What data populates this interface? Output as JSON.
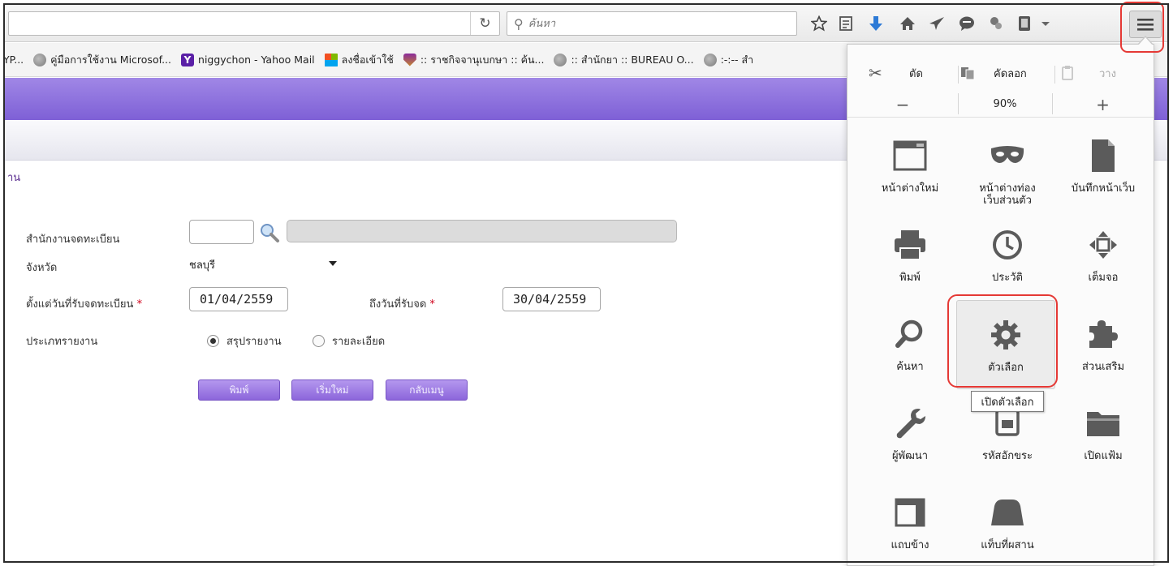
{
  "browser": {
    "search": {
      "placeholder": "ค้นหา"
    },
    "zoom_level": "90%",
    "bookmarks": [
      {
        "label": "YP...",
        "favicon_color": "#8a8a8a"
      },
      {
        "label": "คู่มือการใช้งาน Microsof...",
        "favicon_color": "#8a8a8a"
      },
      {
        "label": "niggychon - Yahoo Mail",
        "favicon_color": "#5a1fa6"
      },
      {
        "label": "ลงชื่อเข้าใช้",
        "favicon_color": "#f25022"
      },
      {
        "label": ":: ราชกิจจานุเบกษา :: ค้น...",
        "favicon_color": "#8b2a9c"
      },
      {
        "label": ":: สำนักยา :: BUREAU O...",
        "favicon_color": "#8a8a8a"
      },
      {
        "label": ":-:-- สำ",
        "favicon_color": "#8a8a8a"
      }
    ]
  },
  "menu": {
    "edit": {
      "cut": "ตัด",
      "copy": "คัดลอก",
      "paste": "วาง"
    },
    "zoom": {
      "minus": "−",
      "plus": "+"
    },
    "items": [
      {
        "label_line1": "หน้าต่างใหม่",
        "label_line2": ""
      },
      {
        "label_line1": "หน้าต่างท่อง",
        "label_line2": "เว็บส่วนตัว"
      },
      {
        "label_line1": "บันทึกหน้าเว็บ",
        "label_line2": ""
      },
      {
        "label_line1": "พิมพ์",
        "label_line2": ""
      },
      {
        "label_line1": "ประวัติ",
        "label_line2": ""
      },
      {
        "label_line1": "เต็มจอ",
        "label_line2": ""
      },
      {
        "label_line1": "ค้นหา",
        "label_line2": ""
      },
      {
        "label_line1": "ตัวเลือก",
        "label_line2": ""
      },
      {
        "label_line1": "ส่วนเสริม",
        "label_line2": ""
      },
      {
        "label_line1": "ผู้พัฒนา",
        "label_line2": ""
      },
      {
        "label_line1": "รหัสอักขระ",
        "label_line2": ""
      },
      {
        "label_line1": "เปิดแฟ้ม",
        "label_line2": ""
      },
      {
        "label_line1": "แถบข้าง",
        "label_line2": ""
      },
      {
        "label_line1": "แท็บที่ผสาน",
        "label_line2": ""
      }
    ],
    "tooltip": "เปิดตัวเลือก"
  },
  "page": {
    "heading_fragment": "าน",
    "form": {
      "office_label": "สำนักงานจดทะเบียน",
      "office_code": "",
      "office_name": "",
      "province_label": "จังหวัด",
      "province_value": "ชลบุรี",
      "from_date_label": "ตั้งแต่วันที่รับจดทะเบียน",
      "from_date": "01/04/2559",
      "to_date_label": "ถึงวันที่รับจด",
      "to_date": "30/04/2559",
      "required_mark": "*",
      "report_type_label": "ประเภทรายงาน",
      "report_options": [
        "สรุปรายงาน",
        "รายละเอียด"
      ],
      "selected_option": 0
    },
    "buttons": {
      "print": "พิมพ์",
      "reset": "เริ่มใหม่",
      "back": "กลับเมนู"
    }
  },
  "colors": {
    "banner": "#7e60d6",
    "button": "#8c66db",
    "highlight": "#e53935",
    "icon_gray": "#5b5b5b",
    "download_blue": "#2d7ad6"
  }
}
